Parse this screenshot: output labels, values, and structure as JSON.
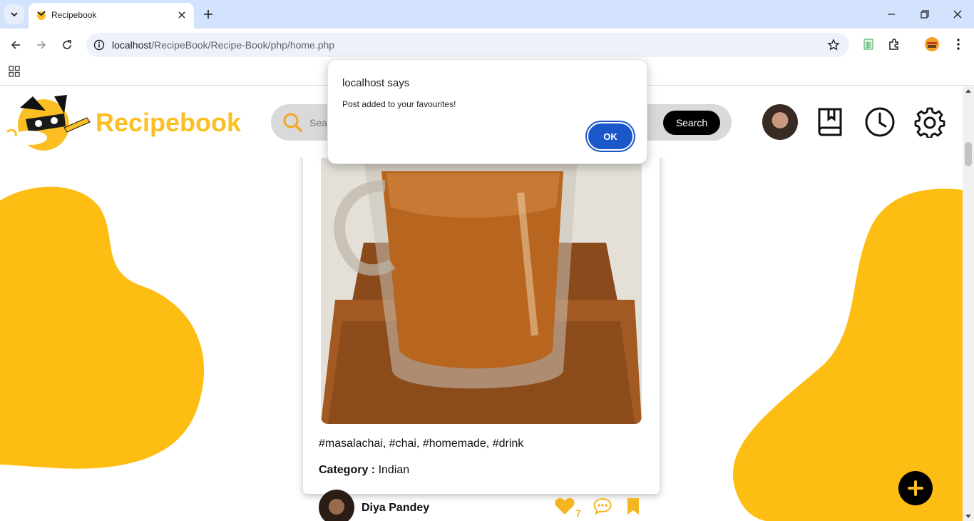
{
  "browser": {
    "tab_title": "Recipebook",
    "url_host": "localhost",
    "url_path": "/RecipeBook/Recipe-Book/php/home.php"
  },
  "header": {
    "brand": "Recipebook",
    "search_placeholder": "Search",
    "search_button": "Search"
  },
  "post": {
    "tags": "#masalachai, #chai, #homemade, #drink",
    "category_label": "Category :",
    "category_value": "Indian",
    "author": "Diya Pandey",
    "likes": "7"
  },
  "dialog": {
    "title": "localhost says",
    "message": "Post added to your favourites!",
    "ok": "OK"
  },
  "colors": {
    "accent": "#fbbf24",
    "ok_button": "#1a57c9"
  }
}
